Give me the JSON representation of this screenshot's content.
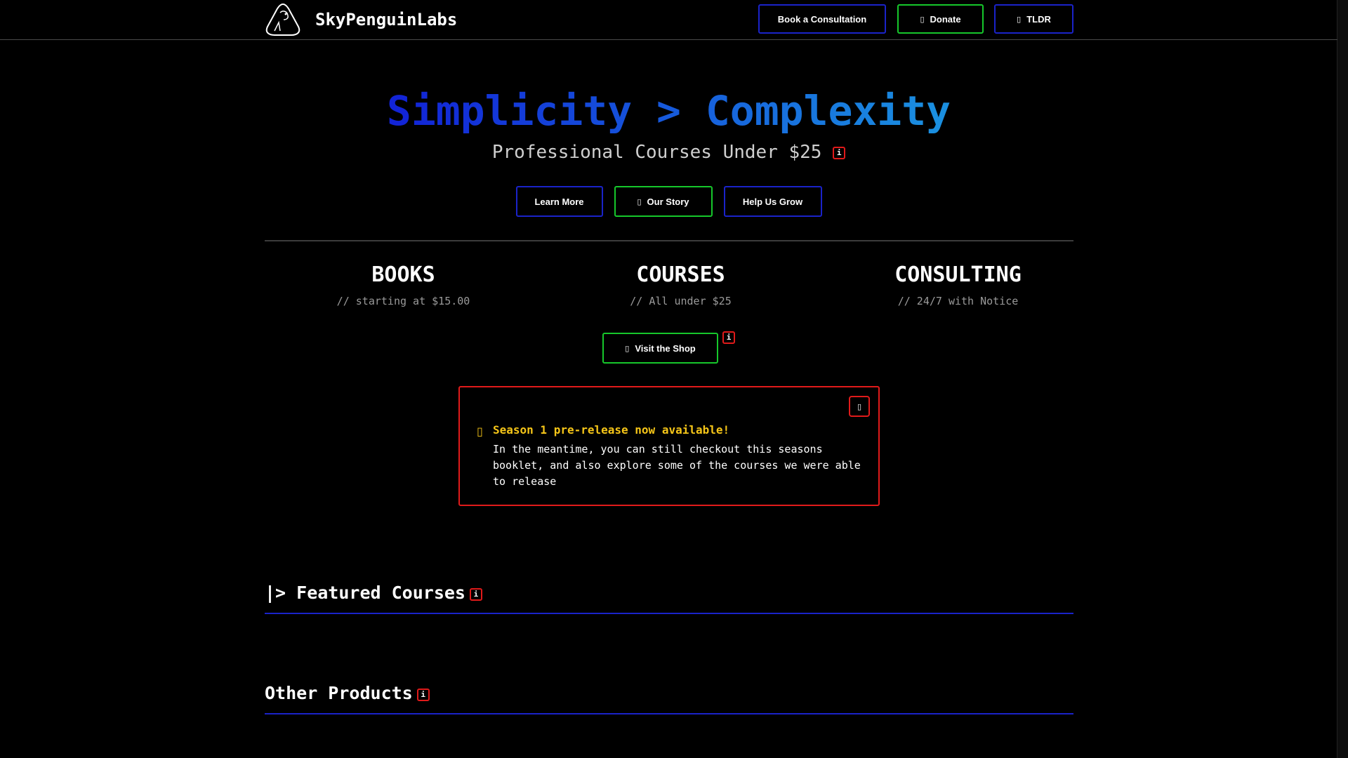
{
  "brand": {
    "name": "SkyPenguinLabs"
  },
  "nav": {
    "consult_label": "Book a Consultation",
    "donate_label": "Donate",
    "tldr_label": "TLDR"
  },
  "hero": {
    "title": "Simplicity > Complexity",
    "subtitle": "Professional Courses Under $25",
    "buttons": {
      "learn_more": "Learn More",
      "our_story": "Our Story",
      "help": "Help Us Grow"
    }
  },
  "info_glyph": "i",
  "offerings": [
    {
      "title": "BOOKS",
      "sub": "// starting at $15.00"
    },
    {
      "title": "COURSES",
      "sub": "// All under $25"
    },
    {
      "title": "CONSULTING",
      "sub": "// 24/7 with Notice"
    }
  ],
  "shop": {
    "label": "Visit the Shop"
  },
  "alert": {
    "title": "Season 1 pre-release now available!",
    "body": "In the meantime, you can still checkout this seasons booklet, and also explore some of the courses we were able to release"
  },
  "sections": {
    "featured": "|> Featured Courses",
    "other": "Other Products"
  },
  "colors": {
    "blue_border": "#1a23c9",
    "green_border": "#16c72b",
    "red_border": "#e01a1a",
    "alert_yellow": "#f5c518",
    "gradient_start": "#1224d6",
    "gradient_end": "#1a8fe0"
  },
  "icons": {
    "donate": "heart-icon",
    "tldr": "list-icon",
    "story": "book-icon",
    "shop": "cart-icon",
    "alert": "warning-icon",
    "close": "close-icon"
  }
}
